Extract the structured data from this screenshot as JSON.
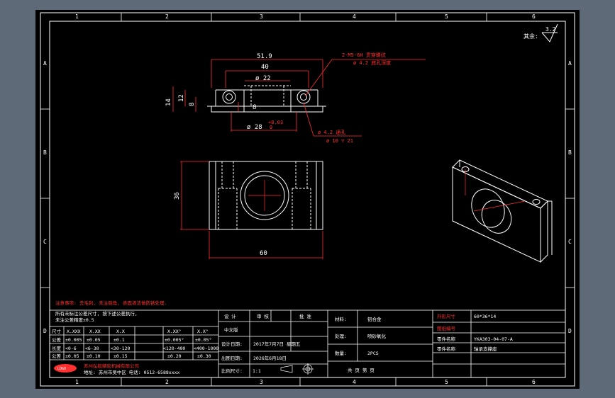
{
  "border": {
    "top_numbers": [
      "1",
      "2",
      "3",
      "4",
      "5",
      "6"
    ],
    "bottom_numbers": [
      "1",
      "2",
      "3",
      "4",
      "5",
      "6"
    ],
    "left_letters": [
      "A",
      "B",
      "C",
      "D"
    ],
    "right_letters": [
      "A",
      "B",
      "C",
      "D"
    ]
  },
  "roughness": {
    "label": "其余:",
    "value": "3.2"
  },
  "front_view": {
    "dim_overall": "51.9",
    "dim_inner": "40",
    "dim_bore": "ø 22",
    "dim_height_14": "14",
    "dim_height_12": "12",
    "dim_height_8": "8",
    "dim_height_8b": "8",
    "dim_bottom_bore": "ø 28",
    "dim_bottom_tol_upper": "+0.03",
    "dim_bottom_tol_lower": "0",
    "callout_top_1": "2-M5-6H 贯穿螺纹",
    "callout_top_2": "ø 4.2 底孔深度",
    "callout_bottom_1": "ø 4.2 通孔",
    "callout_bottom_2": "ø 10 ▽ 21"
  },
  "top_view": {
    "dim_height": "36",
    "dim_width": "60"
  },
  "notes": {
    "red_line": "注意事项: 去毛刺, 未注倒角, 表面清洁做防锈处理.",
    "line1": "所有未标注公差尺寸, 按下述公差执行,",
    "line2": "未注公差精度±0.5"
  },
  "tolerance_table": {
    "headers": [
      "尺寸",
      "X.XXX",
      "X.XX",
      "X.X",
      "X.XX°",
      "X.X°"
    ],
    "rows": [
      [
        "公差",
        "±0.005",
        "±0.05",
        "±0.1",
        "±0.005°",
        "±0.05°"
      ],
      [
        "长度",
        "<0-6",
        "<6-30",
        "<30-120",
        "<120-400",
        "<400-1000"
      ],
      [
        "公差",
        "±0.05",
        "±0.10",
        "±0.15",
        "±0.20",
        "±0.30"
      ]
    ]
  },
  "company": {
    "logo_text": "LOGO",
    "name": "苏州弘毅精密机械有限公司",
    "address": "地址: 苏州市吴中区 电话: 0512-6588xxxx"
  },
  "title_block": {
    "designer_label": "设 计",
    "reviewer_label": "审 核",
    "approver_label": "批 准",
    "doc_label": "中文版",
    "design_date_label": "设计日期:",
    "design_date_value": "2017年7月7日 星期五",
    "print_date_label": "出图日期:",
    "print_date_value": "2026年6月18日",
    "scale_label": "比例尺寸:",
    "scale_value": "1:1",
    "material_label": "材料:",
    "material_value": "铝合金",
    "surface_label": "处理:",
    "surface_value": "喷砂氧化",
    "qty_label": "数量:",
    "qty_value": "2PCS",
    "sheet_label": "共 页  第 页",
    "size_label": "外形尺寸",
    "size_value": "60*36*14",
    "part_no_label": "图纸编号",
    "part_no_value": "YKA303-04-07-A",
    "part_name_label": "零件名称",
    "part_name_value": "轴承支撑座",
    "assembly_label": "零件名称"
  }
}
